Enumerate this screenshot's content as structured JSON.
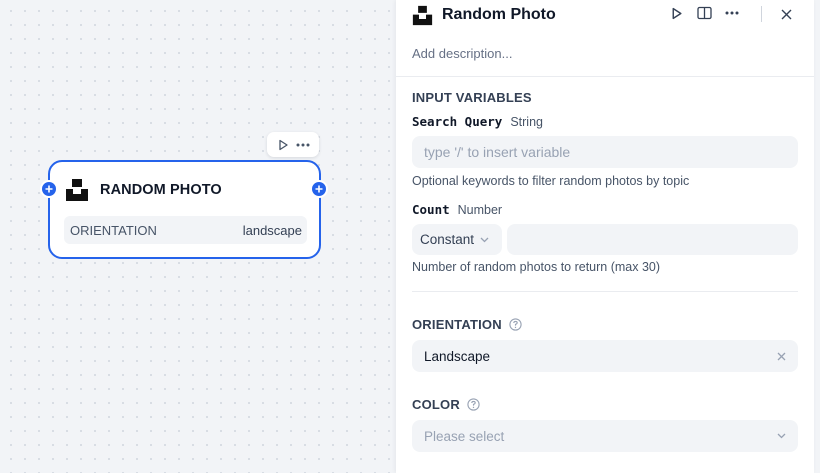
{
  "node": {
    "title": "RANDOM PHOTO",
    "param_label": "ORIENTATION",
    "param_value": "landscape",
    "toolbar_icons": [
      "play-icon",
      "more-icon"
    ]
  },
  "panel": {
    "title": "Random Photo",
    "header_icons": [
      "play-icon",
      "book-icon",
      "more-icon",
      "close-icon"
    ],
    "description_placeholder": "Add description...",
    "input_variables_label": "INPUT VARIABLES",
    "search_query": {
      "name": "Search Query",
      "type": "String",
      "placeholder": "type '/' to insert variable",
      "hint": "Optional keywords to filter random photos by topic"
    },
    "count": {
      "name": "Count",
      "type": "Number",
      "mode": "Constant",
      "hint": "Number of random photos to return (max 30)"
    },
    "orientation": {
      "label": "ORIENTATION",
      "value": "Landscape"
    },
    "color": {
      "label": "COLOR",
      "placeholder": "Please select"
    }
  },
  "colors": {
    "accent": "#2563eb",
    "canvas_bg": "#f2f4f7",
    "field_bg": "#f2f4f7"
  }
}
